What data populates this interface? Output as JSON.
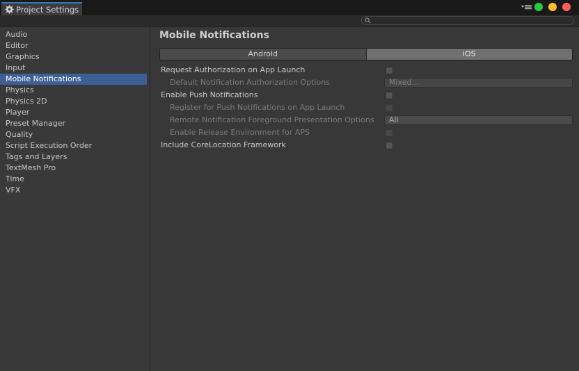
{
  "window": {
    "tab_title": "Project Settings",
    "tab_icon": "gear-icon",
    "controls": [
      "menu-icon",
      "green-dot",
      "yellow-dot",
      "red-dot"
    ]
  },
  "search": {
    "placeholder": ""
  },
  "sidebar": {
    "items": [
      {
        "label": "Audio"
      },
      {
        "label": "Editor"
      },
      {
        "label": "Graphics"
      },
      {
        "label": "Input"
      },
      {
        "label": "Mobile Notifications",
        "selected": true
      },
      {
        "label": "Physics"
      },
      {
        "label": "Physics 2D"
      },
      {
        "label": "Player"
      },
      {
        "label": "Preset Manager"
      },
      {
        "label": "Quality"
      },
      {
        "label": "Script Execution Order"
      },
      {
        "label": "Tags and Layers"
      },
      {
        "label": "TextMesh Pro"
      },
      {
        "label": "Time"
      },
      {
        "label": "VFX"
      }
    ]
  },
  "main": {
    "title": "Mobile Notifications",
    "platform_tabs": [
      {
        "label": "Android",
        "selected": false
      },
      {
        "label": "iOS",
        "selected": true
      }
    ],
    "settings": {
      "request_auth": {
        "label": "Request Authorization on App Launch",
        "checked": false
      },
      "default_auth_options": {
        "label": "Default Notification Authorization Options",
        "value": "Mixed..."
      },
      "enable_push": {
        "label": "Enable Push Notifications",
        "checked": false
      },
      "register_push": {
        "label": "Register for Push Notifications on App Launch",
        "checked": false
      },
      "remote_foreground": {
        "label": "Remote Notification Foreground Presentation Options",
        "value": "All"
      },
      "release_env": {
        "label": "Enable Release Environment for APS",
        "checked": false
      },
      "core_location": {
        "label": "Include CoreLocation Framework",
        "checked": false
      }
    }
  },
  "colors": {
    "background": "#383838",
    "selected": "#3e5f96",
    "titlebar": "#191919",
    "green": "#27c93f",
    "yellow": "#ffbd2e",
    "red": "#ff5f57"
  }
}
